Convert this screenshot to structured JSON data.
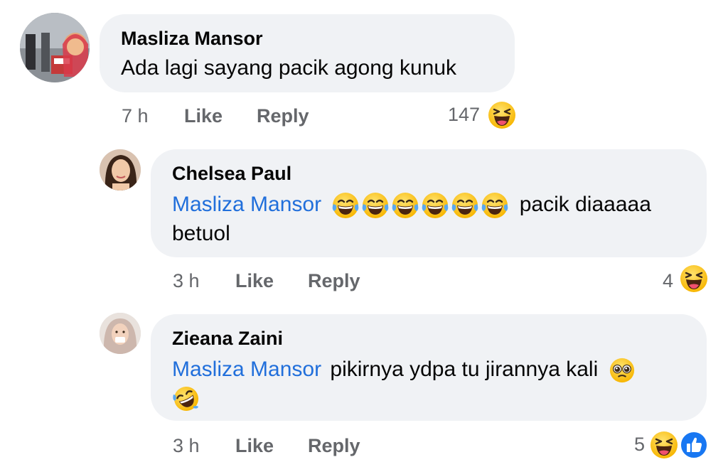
{
  "comments": [
    {
      "author": "Masliza Mansor",
      "text": "Ada lagi sayang pacik agong kunuk",
      "time": "7 h",
      "like": "Like",
      "reply": "Reply",
      "reaction_count": "147",
      "reaction_icons": [
        "laughing-squint-face-icon"
      ]
    },
    {
      "author": "Chelsea Paul",
      "mention": "Masliza Mansor",
      "text_after_emojis": "pacik diaaaaa",
      "text_line2": "betuol",
      "inline_emojis": [
        "tears-of-joy-icon",
        "tears-of-joy-icon",
        "tears-of-joy-icon",
        "tears-of-joy-icon",
        "tears-of-joy-icon",
        "tears-of-joy-icon"
      ],
      "time": "3 h",
      "like": "Like",
      "reply": "Reply",
      "reaction_count": "4",
      "reaction_icons": [
        "laughing-squint-face-icon"
      ]
    },
    {
      "author": "Zieana Zaini",
      "mention": "Masliza Mansor",
      "text": "pikirnya ydpa tu jirannya kali",
      "inline_emojis": [
        "pleading-face-icon",
        "rolling-laughing-icon"
      ],
      "time": "3 h",
      "like": "Like",
      "reply": "Reply",
      "reaction_count": "5",
      "reaction_icons": [
        "laughing-squint-face-icon",
        "like-thumb-icon"
      ]
    }
  ],
  "colors": {
    "bubble": "#f0f2f5",
    "mention": "#216fdb",
    "meta": "#65676b",
    "emoji_yellow": "#ffcc33",
    "like_blue": "#1877f2"
  }
}
